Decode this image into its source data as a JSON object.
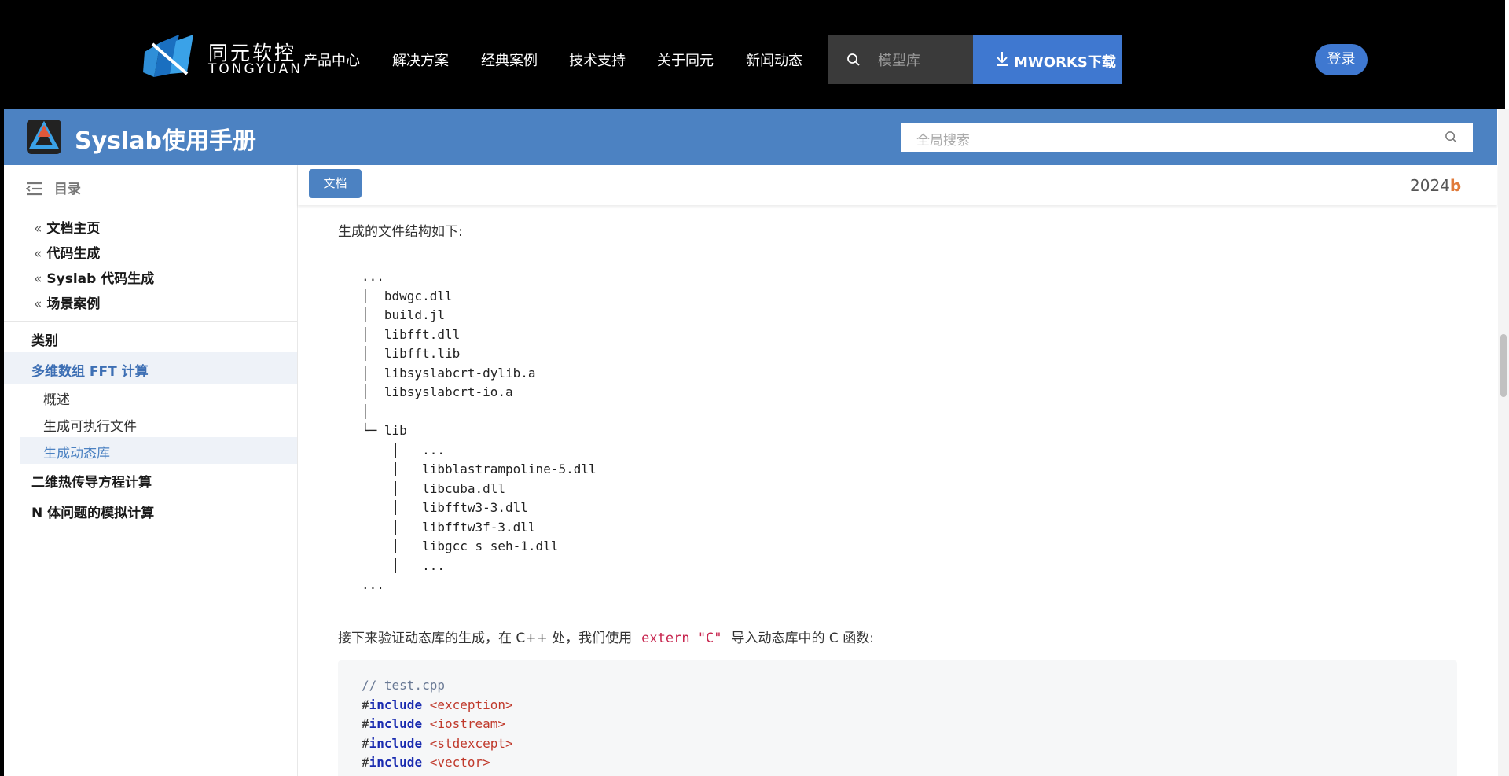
{
  "topnav": {
    "logo_text": "同元软控",
    "logo_sub": "TONGYUAN",
    "items": [
      "产品中心",
      "解决方案",
      "经典案例",
      "技术支持",
      "关于同元",
      "新闻动态"
    ],
    "search_placeholder": "模型库",
    "download_label": "MWORKS下载",
    "login_label": "登录"
  },
  "header": {
    "title": "Syslab使用手册",
    "search_placeholder": "全局搜索"
  },
  "sidebar": {
    "toc_label": "目录",
    "links": [
      "文档主页",
      "代码生成",
      "Syslab 代码生成",
      "场景案例"
    ],
    "category_label": "类别",
    "active_section": "多维数组 FFT 计算",
    "sub_items": [
      "概述",
      "生成可执行文件",
      "生成动态库"
    ],
    "other_sections": [
      "二维热传导方程计算",
      "N 体问题的模拟计算"
    ]
  },
  "subbar": {
    "doc_button": "文档",
    "version_year": "2024",
    "version_suffix": "b"
  },
  "content": {
    "intro": "生成的文件结构如下:",
    "tree": "...\n│  bdwgc.dll\n│  build.jl\n│  libfft.dll\n│  libfft.lib\n│  libsyslabcrt-dylib.a\n│  libsyslabcrt-io.a\n│\n└─ lib\n    │   ...\n    │   libblastrampoline-5.dll\n    │   libcuba.dll\n    │   libfftw3-3.dll\n    │   libfftw3f-3.dll\n    │   libgcc_s_seh-1.dll\n    │   ...\n...",
    "para2_before": "接下来验证动态库的生成，在 C++ 处，我们使用",
    "para2_code": "extern \"C\"",
    "para2_after": "导入动态库中的 C 函数:",
    "code_comment": "// test.cpp",
    "includes": [
      {
        "hash": "#",
        "kw": "include",
        "header": "<exception>"
      },
      {
        "hash": "#",
        "kw": "include",
        "header": "<iostream>"
      },
      {
        "hash": "#",
        "kw": "include",
        "header": "<stdexcept>"
      },
      {
        "hash": "#",
        "kw": "include",
        "header": "<vector>"
      }
    ]
  },
  "colors": {
    "nav_bg": "#000000",
    "brand_blue": "#4c82c2",
    "button_blue": "#3f78d0",
    "version_accent": "#e07a3a"
  }
}
